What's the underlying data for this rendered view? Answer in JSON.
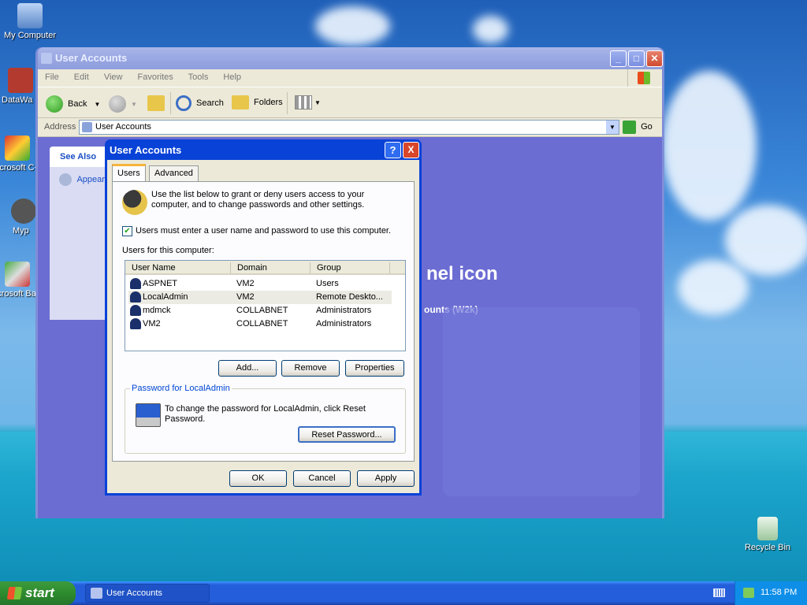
{
  "desktop": {
    "icons": [
      {
        "label": "My Computer"
      },
      {
        "label": "DataWa"
      },
      {
        "label": "Microsoft C++"
      },
      {
        "label": "Myp"
      },
      {
        "label": "Microsoft Basic"
      },
      {
        "label": "Recycle Bin"
      }
    ]
  },
  "explorer": {
    "title": "User Accounts",
    "menu": [
      "File",
      "Edit",
      "View",
      "Favorites",
      "Tools",
      "Help"
    ],
    "toolbar": {
      "back": "Back",
      "search": "Search",
      "folders": "Folders"
    },
    "address_label": "Address",
    "address_value": "User Accounts",
    "go_label": "Go",
    "see_also": {
      "header": "See Also",
      "item": "Appear"
    },
    "bg_heading": "nel icon",
    "bg_subtext": "ounts (W2k)"
  },
  "dialog": {
    "title": "User Accounts",
    "help_btn": "?",
    "close_btn": "X",
    "tabs": [
      "Users",
      "Advanced"
    ],
    "intro": "Use the list below to grant or deny users access to your computer, and to change passwords and other settings.",
    "checkbox_label": "Users must enter a user name and password to use this computer.",
    "checkbox_checked": true,
    "list_label": "Users for this computer:",
    "columns": [
      "User Name",
      "Domain",
      "Group"
    ],
    "rows": [
      {
        "name": "ASPNET",
        "domain": "VM2",
        "group": "Users"
      },
      {
        "name": "LocalAdmin",
        "domain": "VM2",
        "group": "Remote Deskto..."
      },
      {
        "name": "mdmck",
        "domain": "COLLABNET",
        "group": "Administrators"
      },
      {
        "name": "VM2",
        "domain": "COLLABNET",
        "group": "Administrators"
      }
    ],
    "buttons": {
      "add": "Add...",
      "remove": "Remove",
      "properties": "Properties"
    },
    "password_group": {
      "title": "Password for LocalAdmin",
      "text": "To change the password for LocalAdmin, click Reset Password.",
      "reset": "Reset Password..."
    },
    "footer": {
      "ok": "OK",
      "cancel": "Cancel",
      "apply": "Apply"
    }
  },
  "taskbar": {
    "start": "start",
    "task": "User Accounts",
    "clock": "11:58 PM"
  }
}
